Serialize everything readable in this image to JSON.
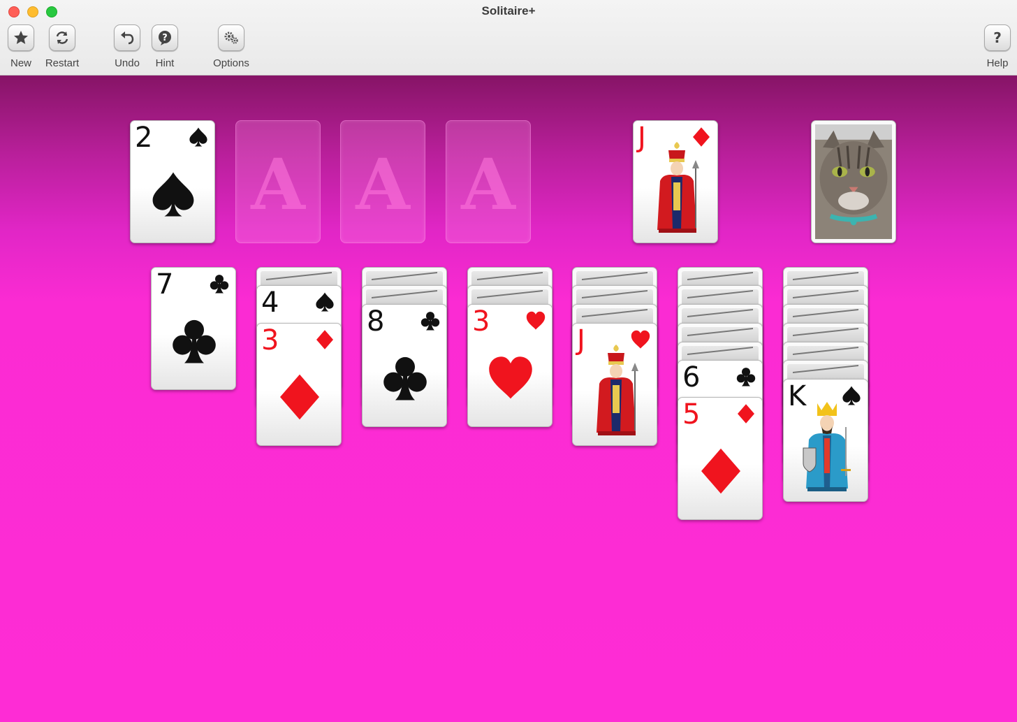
{
  "window": {
    "title": "Solitaire+"
  },
  "toolbar": {
    "new_label": "New",
    "restart_label": "Restart",
    "undo_label": "Undo",
    "hint_label": "Hint",
    "options_label": "Options",
    "help_label": "Help"
  },
  "colors": {
    "felt_top": "#861466",
    "felt_bottom": "#fe2cd5",
    "red_suit": "#f0141e",
    "black_suit": "#111111"
  },
  "foundations": {
    "pile1_rank": "2",
    "pile1_suit": "spades",
    "empty_label_2": "A",
    "empty_label_3": "A",
    "empty_label_4": "A"
  },
  "waste": {
    "rank": "J",
    "suit": "diamonds"
  },
  "stock": {
    "back_image": "cat"
  },
  "tableau": {
    "col1_top_rank": "7",
    "col1_top_suit": "clubs",
    "col2_card1_rank": "4",
    "col2_card1_suit": "spades",
    "col2_card2_rank": "3",
    "col2_card2_suit": "diamonds",
    "col3_top_rank": "8",
    "col3_top_suit": "clubs",
    "col4_top_rank": "3",
    "col4_top_suit": "hearts",
    "col5_top_rank": "J",
    "col5_top_suit": "hearts",
    "col6_card1_rank": "6",
    "col6_card1_suit": "clubs",
    "col6_card2_rank": "5",
    "col6_card2_suit": "diamonds",
    "col7_top_rank": "K",
    "col7_top_suit": "spades",
    "hidden_counts": [
      0,
      1,
      2,
      2,
      3,
      5,
      6
    ]
  }
}
